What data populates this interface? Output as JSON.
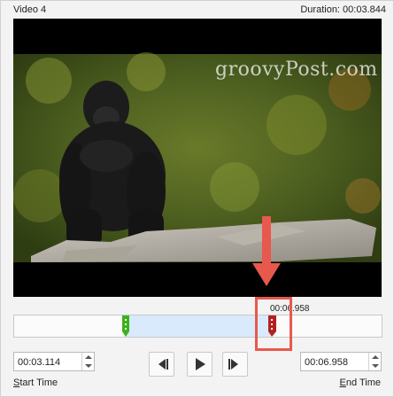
{
  "dialog": {
    "video_title": "Video 4",
    "duration_label": "Duration: 00:03.844"
  },
  "video": {
    "watermark": "groovyPost.com"
  },
  "timeline": {
    "time_readout": "00:06.958",
    "start_handle_color": "#3cb21c",
    "end_handle_color": "#b3201f",
    "selection_color": "#d9eafc"
  },
  "start_time": {
    "value": "00:03.114",
    "label_accel": "S",
    "label_rest": "tart Time"
  },
  "end_time": {
    "value": "00:06.958",
    "label_accel": "E",
    "label_rest": "nd Time"
  },
  "controls": {
    "previous_frame_icon": "previous-frame-icon",
    "play_icon": "play-icon",
    "next_frame_icon": "next-frame-icon"
  },
  "annotation": {
    "arrow_color": "#e9584c"
  }
}
